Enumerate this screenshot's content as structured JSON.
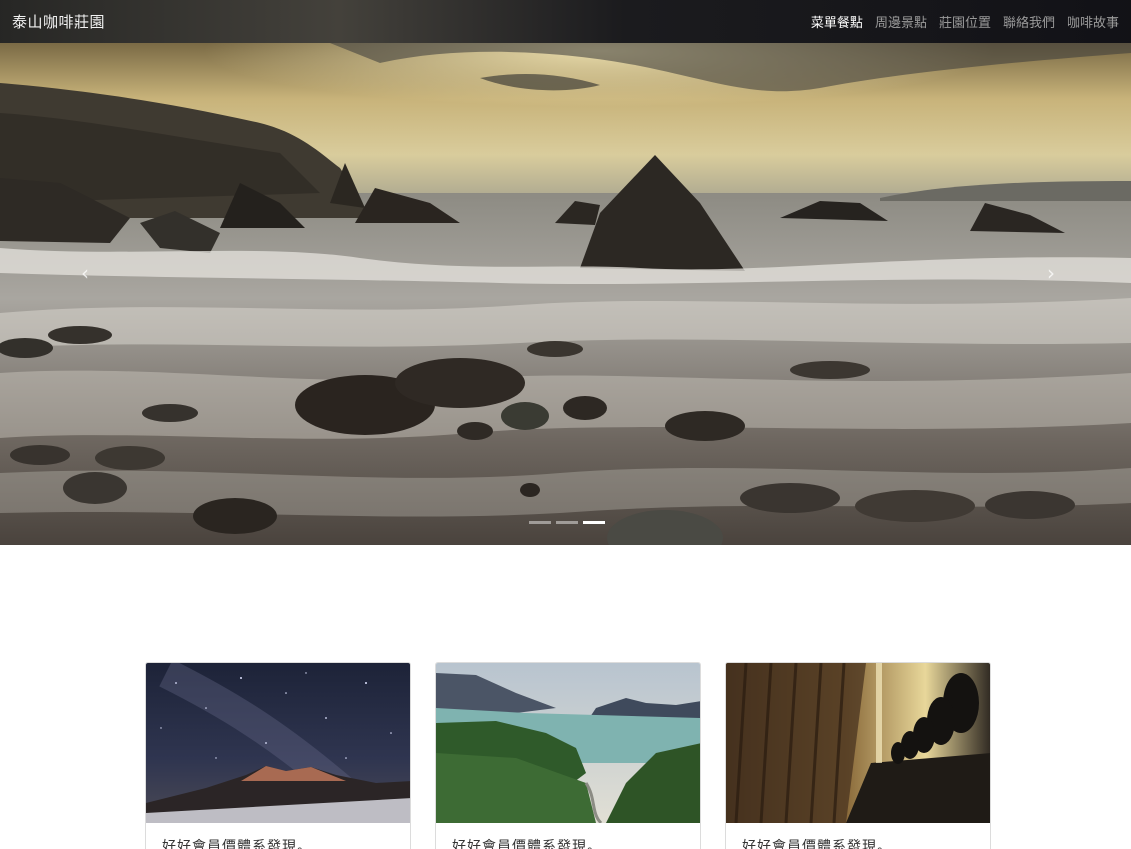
{
  "navbar": {
    "brand": "泰山咖啡莊園",
    "links": [
      {
        "label": "菜單餐點",
        "active": true
      },
      {
        "label": "周邊景點",
        "active": false
      },
      {
        "label": "莊園位置",
        "active": false
      },
      {
        "label": "聯絡我們",
        "active": false
      },
      {
        "label": "咖啡故事",
        "active": false
      }
    ]
  },
  "carousel": {
    "prev_icon": "chevron-left-icon",
    "next_icon": "chevron-right-icon",
    "prev_glyph": "‹",
    "next_glyph": "›",
    "slide_count": 3,
    "active_slide": 3
  },
  "cards": [
    {
      "image": "starry-night-mountain",
      "text": "好好會員價體系發現。"
    },
    {
      "image": "lake-valley-forest",
      "text": "好好會員價體系發現。"
    },
    {
      "image": "theater-seats",
      "text": "好好會員價體系發現。"
    }
  ],
  "colors": {
    "nav_active": "#ffffff",
    "nav_inactive": "#9a9a9a",
    "card_border": "#dcdcdc"
  }
}
